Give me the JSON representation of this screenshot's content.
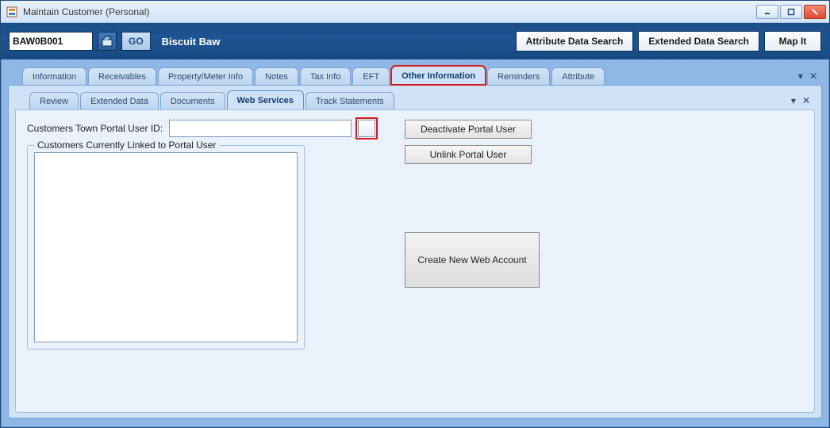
{
  "window": {
    "title": "Maintain Customer (Personal)"
  },
  "toolbar": {
    "customer_code": "BAW0B001",
    "go_label": "GO",
    "customer_name": "Biscuit Baw",
    "attribute_search_label": "Attribute Data Search",
    "extended_search_label": "Extended Data Search",
    "map_it_label": "Map It"
  },
  "primary_tabs": [
    {
      "label": "Information"
    },
    {
      "label": "Receivables"
    },
    {
      "label": "Property/Meter Info"
    },
    {
      "label": "Notes"
    },
    {
      "label": "Tax Info"
    },
    {
      "label": "EFT"
    },
    {
      "label": "Other Information",
      "active": true,
      "highlight": true
    },
    {
      "label": "Reminders"
    },
    {
      "label": "Attribute"
    }
  ],
  "secondary_tabs": [
    {
      "label": "Review"
    },
    {
      "label": "Extended Data"
    },
    {
      "label": "Documents"
    },
    {
      "label": "Web Services",
      "active": true
    },
    {
      "label": "Track Statements"
    }
  ],
  "web_services": {
    "portal_user_id_label": "Customers Town Portal User ID:",
    "portal_user_id_value": "",
    "linked_group_label": "Customers Currently Linked to Portal User",
    "deactivate_label": "Deactivate Portal User",
    "unlink_label": "Unlink Portal User",
    "create_label": "Create New Web Account"
  }
}
